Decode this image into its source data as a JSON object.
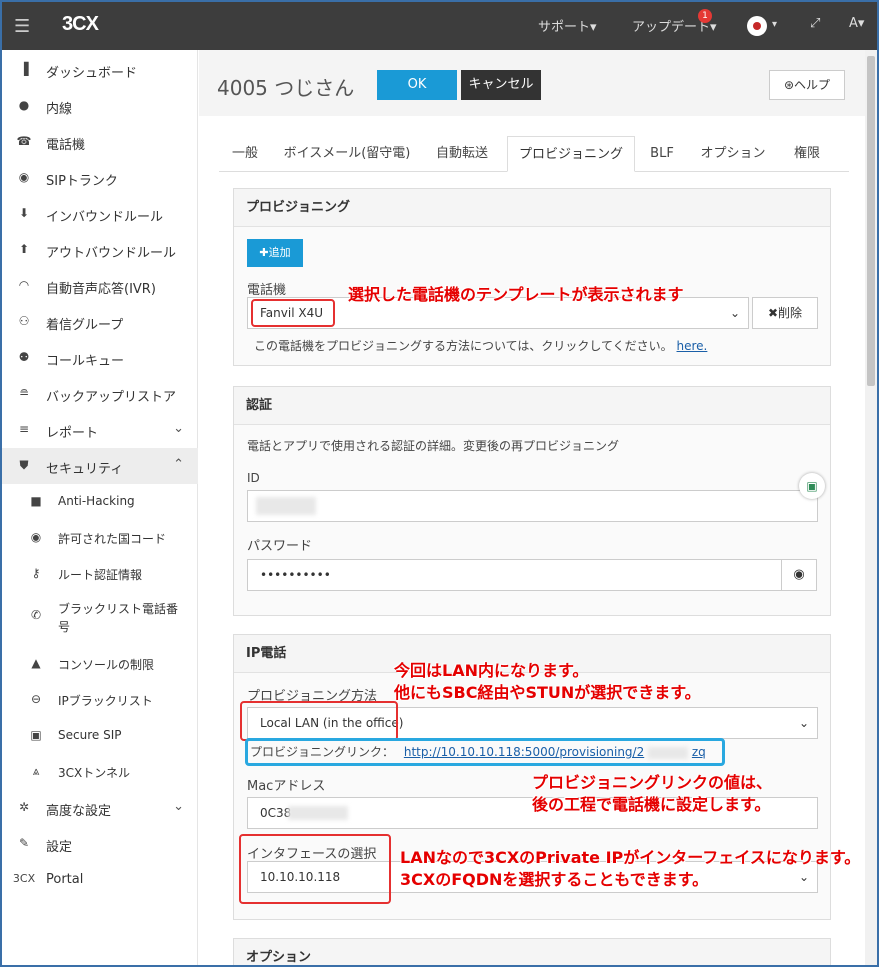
{
  "topbar": {
    "logo": "3CX",
    "support": "サポート▾",
    "update": "アップデート▾",
    "update_badge": "1",
    "expand_icon": "expand-icon",
    "user": "A▾"
  },
  "sidebar": {
    "items": [
      {
        "icon": "bar-chart-icon",
        "label": "ダッシュボード"
      },
      {
        "icon": "user-icon",
        "label": "内線"
      },
      {
        "icon": "phone-icon",
        "label": "電話機"
      },
      {
        "icon": "globe-icon",
        "label": "SIPトランク"
      },
      {
        "icon": "arrow-down-icon",
        "label": "インバウンドルール"
      },
      {
        "icon": "arrow-up-icon",
        "label": "アウトバウンドルール"
      },
      {
        "icon": "headset-icon",
        "label": "自動音声応答(IVR)"
      },
      {
        "icon": "group-icon",
        "label": "着信グループ"
      },
      {
        "icon": "users-icon",
        "label": "コールキュー"
      },
      {
        "icon": "database-icon",
        "label": "バックアップリストア"
      },
      {
        "icon": "list-icon",
        "label": "レポート"
      },
      {
        "icon": "shield-icon",
        "label": "セキュリティ"
      },
      {
        "icon": "lock-icon",
        "label": "Anti-Hacking"
      },
      {
        "icon": "globe-icon",
        "label": "許可された国コード"
      },
      {
        "icon": "key-icon",
        "label": "ルート認証情報"
      },
      {
        "icon": "phone-icon",
        "label": "ブラックリスト電話番"
      },
      {
        "icon": "warning-icon",
        "label": "コンソールの制限"
      },
      {
        "icon": "block-icon",
        "label": "IPブラックリスト"
      },
      {
        "icon": "lock-icon",
        "label": "Secure SIP"
      },
      {
        "icon": "tunnel-icon",
        "label": "3CXトンネル"
      },
      {
        "icon": "cog-icon",
        "label": "高度な設定"
      },
      {
        "icon": "wrench-icon",
        "label": "設定"
      },
      {
        "icon": "portal-icon",
        "label": "Portal"
      }
    ],
    "blacklist_line2": "号",
    "portal_prefix": "3CX"
  },
  "header": {
    "title": "4005 つじさん",
    "ok": "OK",
    "cancel": "キャンセル",
    "help": "ヘルプ"
  },
  "tabs": [
    "一般",
    "ボイスメール(留守電)",
    "自動転送",
    "プロビジョニング",
    "BLF",
    "オプション",
    "権限"
  ],
  "provisioning": {
    "heading": "プロビジョニング",
    "add": "追加",
    "phone_label": "電話機",
    "phone_value": "Fanvil X4U",
    "delete": "削除",
    "help_text": "この電話機をプロビジョニングする方法については、クリックしてください。",
    "help_link": "here."
  },
  "auth": {
    "heading": "認証",
    "desc": "電話とアプリで使用される認証の詳細。変更後の再プロビジョニング",
    "id_label": "ID",
    "password_label": "パスワード",
    "password_value": "••••••••••"
  },
  "ipphone": {
    "heading": "IP電話",
    "method_label": "プロビジョニング方法",
    "method_value": "Local LAN (in the office)",
    "link_label": "プロビジョニングリンク：",
    "link_value": "http://10.10.10.118:5000/provisioning/2",
    "link_tail": "zq",
    "mac_label": "Macアドレス",
    "mac_value": "0C38",
    "iface_label": "インタフェースの選択",
    "iface_value": "10.10.10.118"
  },
  "options": {
    "heading": "オプション"
  },
  "notes": {
    "template": "選択した電話機のテンプレートが表示されます",
    "lan1": "今回はLAN内になります。",
    "lan2": "他にもSBC経由やSTUNが選択できます。",
    "link1": "プロビジョニングリンクの値は、",
    "link2": "後の工程で電話機に設定します。",
    "iface1": "LANなので3CXのPrivate IPがインターフェイスになります。",
    "iface2": "3CXのFQDNを選択することもできます。"
  }
}
